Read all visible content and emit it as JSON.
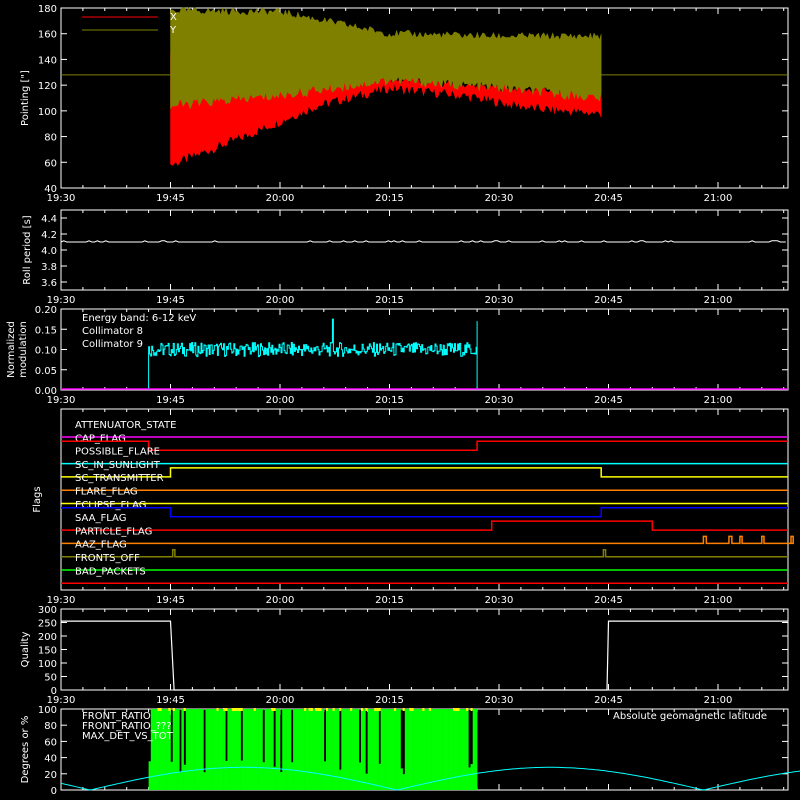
{
  "time_axis": {
    "tick_labels": [
      "19:30",
      "19:45",
      "20:00",
      "20:15",
      "20:30",
      "20:45",
      "21:00"
    ]
  },
  "colors": {
    "x": "#ff0000",
    "y": "#808000",
    "white": "#ffffff",
    "collimator8": "#00ffff",
    "collimator9": "#ff00ff",
    "green": "#00ff00",
    "yellow": "#ffff00",
    "orange": "#ff8000",
    "blue": "#0000ff",
    "cyan": "#00ffff"
  },
  "chart_data": [
    {
      "type": "line",
      "name": "pointing",
      "ylabel": "Pointing [\"]",
      "ylim": [
        40,
        180
      ],
      "yticks": [
        40,
        60,
        80,
        100,
        120,
        140,
        160,
        180
      ],
      "legend": [
        "X",
        "Y"
      ],
      "reference_line": 128,
      "data_window": [
        "19:45",
        "20:44"
      ],
      "series": [
        {
          "name": "X",
          "envelope_upper": [
            [
              0,
              148
            ],
            [
              10,
              135
            ],
            [
              20,
              128
            ],
            [
              30,
              125
            ],
            [
              40,
              120
            ],
            [
              50,
              116
            ]
          ],
          "envelope_lower": [
            [
              0,
              58
            ],
            [
              10,
              80
            ],
            [
              20,
              104
            ],
            [
              30,
              118
            ],
            [
              40,
              112
            ],
            [
              50,
              102
            ],
            [
              59,
              98
            ]
          ]
        },
        {
          "name": "Y",
          "envelope_upper": [
            [
              0,
              178
            ],
            [
              15,
              177
            ],
            [
              30,
              160
            ],
            [
              45,
              158
            ],
            [
              59,
              158
            ]
          ],
          "envelope_lower": [
            [
              0,
              104
            ],
            [
              15,
              112
            ],
            [
              30,
              124
            ],
            [
              45,
              118
            ],
            [
              59,
              110
            ]
          ]
        }
      ]
    },
    {
      "type": "line",
      "name": "roll-period",
      "ylabel": "Roll period [s]",
      "ylim": [
        3.5,
        4.5
      ],
      "yticks": [
        3.6,
        3.8,
        4.0,
        4.2,
        4.4
      ],
      "series": [
        {
          "name": "roll period",
          "value": 4.1,
          "window": [
            "19:30",
            "21:00"
          ]
        }
      ]
    },
    {
      "type": "line",
      "name": "modulation",
      "ylabel": "Normalized modulation",
      "ylim": [
        0.0,
        0.2
      ],
      "yticks": [
        0.0,
        0.05,
        0.1,
        0.15,
        0.2
      ],
      "yticklabels": [
        "0.00",
        "0.05",
        "0.10",
        "0.15",
        "0.20"
      ],
      "annotation": "Energy band: 6-12 keV",
      "legend": [
        "Collimator 8",
        "Collimator 9"
      ],
      "series": [
        {
          "name": "Collimator 8",
          "mean": 0.1,
          "window": [
            "19:42",
            "20:27"
          ],
          "spikes": [
            [
              0,
              0.07
            ],
            [
              60,
              0.17
            ],
            [
              85,
              0.17
            ]
          ]
        },
        {
          "name": "Collimator 9",
          "value": 0.0
        }
      ]
    },
    {
      "type": "line",
      "name": "flags",
      "ylabel": "Flags",
      "rows": [
        {
          "label": "ATTENUATOR_STATE",
          "color": "#ff00ff",
          "steps": []
        },
        {
          "label": "CAP_FLAG",
          "color": "#ff0000",
          "steps": [
            [
              0,
              1
            ],
            [
              12,
              0
            ],
            [
              57,
              1
            ]
          ]
        },
        {
          "label": "POSSIBLE_FLARE",
          "color": "#00ffff",
          "steps": []
        },
        {
          "label": "SC_IN_SUNLIGHT",
          "color": "#ffff00",
          "steps": [
            [
              0,
              0
            ],
            [
              15,
              1
            ],
            [
              74,
              0
            ]
          ]
        },
        {
          "label": "SC_TRANSMITTER",
          "color": "#ff8000",
          "steps": []
        },
        {
          "label": "FLARE_FLAG",
          "color": "#ffff00",
          "steps": []
        },
        {
          "label": "ECLIPSE_FLAG",
          "color": "#0000ff",
          "steps": [
            [
              0,
              1
            ],
            [
              15,
              0
            ],
            [
              74,
              1
            ]
          ]
        },
        {
          "label": "SAA_FLAG",
          "color": "#ff0000",
          "steps": [
            [
              0,
              0
            ],
            [
              59,
              1
            ],
            [
              74,
              1
            ],
            [
              81,
              0
            ]
          ]
        },
        {
          "label": "PARTICLE_FLAG",
          "color": "#ff8000",
          "pulses": [
            [
              88,
              88.4
            ],
            [
              91.5,
              91.9
            ],
            [
              93,
              93.3
            ],
            [
              96,
              96.3
            ],
            [
              100,
              100.3
            ]
          ]
        },
        {
          "label": "AAZ_FLAG",
          "color": "#808000",
          "pulses": [
            [
              15.3,
              15.6
            ],
            [
              74.3,
              74.6
            ]
          ]
        },
        {
          "label": "FRONTS_OFF",
          "color": "#00ff00",
          "steps": []
        },
        {
          "label": "BAD_PACKETS",
          "color": "#ff0000",
          "steps": []
        }
      ]
    },
    {
      "type": "line",
      "name": "quality",
      "ylabel": "Quality",
      "ylim": [
        0,
        300
      ],
      "yticks": [
        0,
        50,
        100,
        150,
        200,
        250,
        300
      ],
      "series": [
        {
          "name": "quality",
          "points": [
            [
              0,
              255
            ],
            [
              15,
              255
            ],
            [
              15.5,
              0
            ],
            [
              74.8,
              0
            ],
            [
              75,
              255
            ],
            [
              105,
              255
            ]
          ]
        }
      ]
    },
    {
      "type": "bar",
      "name": "front-ratio",
      "ylabel": "Degrees or %",
      "ylim": [
        0,
        100
      ],
      "yticks": [
        0,
        20,
        40,
        60,
        80,
        100
      ],
      "legend": [
        "FRONT_RATIO",
        "FRONT_RATIO_???",
        "MAX_DET_VS_TOT"
      ],
      "annotation": "Absolute geomagnetic latitude",
      "window": [
        "19:42",
        "20:27"
      ],
      "series": [
        {
          "name": "Absolute geomagnetic latitude",
          "min": 0,
          "max": 28,
          "peaks_at": [
            "19:55",
            "20:37"
          ]
        }
      ]
    }
  ]
}
